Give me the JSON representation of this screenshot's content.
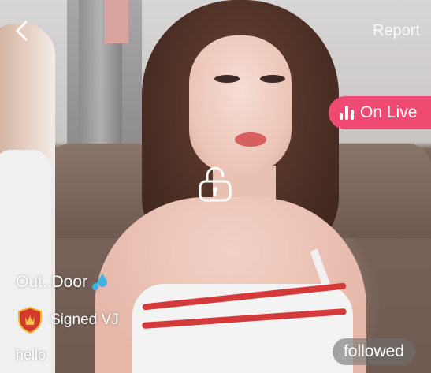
{
  "header": {
    "report_label": "Report",
    "back_icon": "chevron-left-icon"
  },
  "live_badge": {
    "label": "On Live",
    "icon": "live-bars-icon",
    "color": "#ee4a72"
  },
  "center_overlay": {
    "icon": "unlock-icon"
  },
  "vj": {
    "name": "Out..Door",
    "name_icon": "water-drops-icon",
    "badge_icon": "shield-badge-icon",
    "badge_label": "Signed VJ",
    "greeting": "hello"
  },
  "follow": {
    "label": "followed"
  }
}
